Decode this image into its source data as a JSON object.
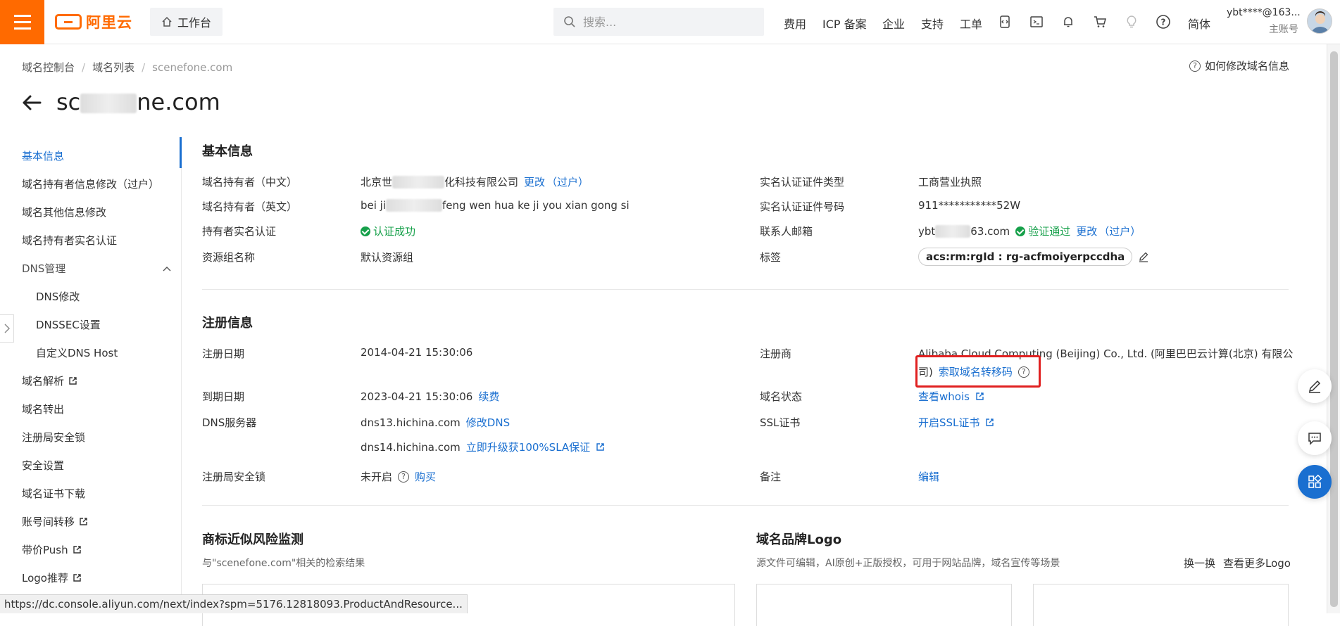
{
  "topbar": {
    "logo_text": "阿里云",
    "workbench_label": "工作台",
    "search_placeholder": "搜索...",
    "nav": [
      "费用",
      "ICP 备案",
      "企业",
      "支持",
      "工单"
    ],
    "lang": "简体",
    "account_name": "ybt****@163...",
    "account_type": "主账号",
    "icons": [
      "app-code-icon",
      "terminal-icon",
      "bell-icon",
      "cart-icon",
      "lightbulb-icon",
      "help-icon"
    ]
  },
  "breadcrumb": {
    "items": [
      "域名控制台",
      "域名列表",
      "scenefone.com"
    ]
  },
  "help_link": "如何修改域名信息",
  "page_title": {
    "prefix": "sc",
    "suffix": "ne.com"
  },
  "sidebar": {
    "items": [
      {
        "label": "基本信息",
        "active": true
      },
      {
        "label": "域名持有者信息修改（过户）"
      },
      {
        "label": "域名其他信息修改"
      },
      {
        "label": "域名持有者实名认证"
      },
      {
        "label": "DNS管理"
      },
      {
        "label": "DNS修改"
      },
      {
        "label": "DNSSEC设置"
      },
      {
        "label": "自定义DNS Host"
      },
      {
        "label": "域名解析"
      },
      {
        "label": "域名转出"
      },
      {
        "label": "注册局安全锁"
      },
      {
        "label": "安全设置"
      },
      {
        "label": "域名证书下载"
      },
      {
        "label": "账号间转移"
      },
      {
        "label": "带价Push"
      },
      {
        "label": "Logo推荐"
      }
    ]
  },
  "basic_info": {
    "title": "基本信息",
    "owner_cn_label": "域名持有者（中文）",
    "owner_cn_prefix": "北京世",
    "owner_cn_suffix": "化科技有限公司",
    "edit": "更改",
    "transfer": "（过户）",
    "owner_en_label": "域名持有者（英文）",
    "owner_en_prefix": "bei ji",
    "owner_en_suffix": "feng wen hua ke ji you xian gong si",
    "realname_label": "持有者实名认证",
    "realname_status": "认证成功",
    "resgroup_label": "资源组名称",
    "resgroup_value": "默认资源组",
    "cert_type_label": "实名认证证件类型",
    "cert_type_value": "工商营业执照",
    "cert_no_label": "实名认证证件号码",
    "cert_no_value": "911***********52W",
    "email_label": "联系人邮箱",
    "email_prefix": "ybt",
    "email_suffix": "63.com",
    "email_status": "验证通过",
    "email_edit": "更改",
    "email_transfer": "（过户）",
    "tag_label": "标签",
    "tag_value": "acs:rm:rgId : rg-acfmoiyerpccdha"
  },
  "reg_info": {
    "title": "注册信息",
    "reg_date_label": "注册日期",
    "reg_date_value": "2014-04-21 15:30:06",
    "expire_label": "到期日期",
    "expire_value": "2023-04-21 15:30:06",
    "renew": "续费",
    "dns_label": "DNS服务器",
    "dns1": "dns13.hichina.com",
    "dns_edit": "修改DNS",
    "dns2": "dns14.hichina.com",
    "dns_upgrade": "立即升级获100%SLA保证",
    "lock_label": "注册局安全锁",
    "lock_value": "未开启",
    "lock_buy": "购买",
    "registrar_label": "注册商",
    "registrar_line1": "Alibaba Cloud Computing (Beijing) Co., Ltd. (阿里巴巴云计算(北京) 有限公",
    "registrar_line2": "司)",
    "transfer_code": "索取域名转移码",
    "status_label": "域名状态",
    "whois": "查看whois",
    "ssl_label": "SSL证书",
    "ssl_link": "开启SSL证书",
    "remark_label": "备注",
    "remark_edit": "编辑"
  },
  "trademark": {
    "title": "商标近似风险监测",
    "desc": "与\"scenefone.com\"相关的检索结果"
  },
  "brand_logo": {
    "title": "域名品牌Logo",
    "desc": "源文件可编辑，AI原创+正版授权，可用于网站品牌，域名宣传等场景",
    "refresh": "换一换",
    "more": "查看更多Logo"
  },
  "status_url": "https://dc.console.aliyun.com/next/index?spm=5176.12818093.ProductAndResource..."
}
